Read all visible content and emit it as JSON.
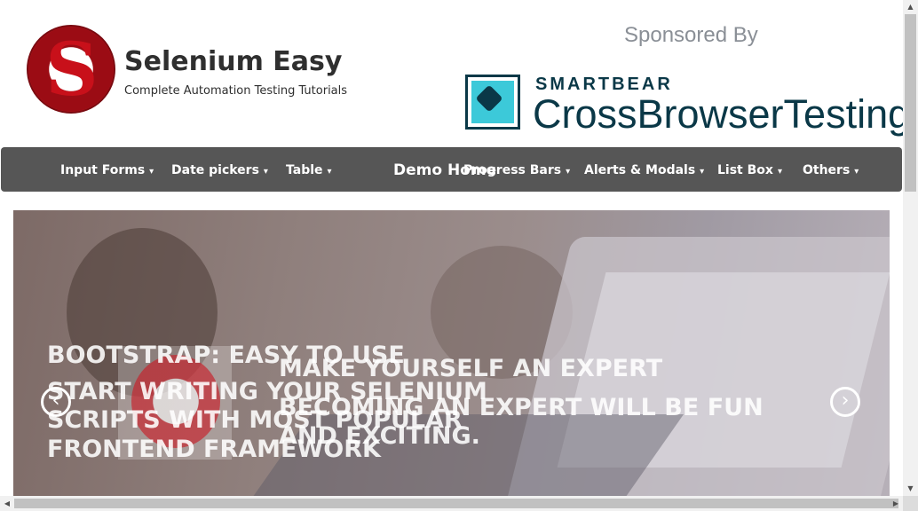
{
  "header": {
    "brand_title": "Selenium Easy",
    "brand_subtitle": "Complete Automation Testing Tutorials",
    "sponsor_label": "Sponsored By",
    "sponsor_company": "SMARTBEAR",
    "sponsor_product": "CrossBrowserTesting"
  },
  "navbar": {
    "items": [
      {
        "label": "Input Forms"
      },
      {
        "label": "Date pickers"
      },
      {
        "label": "Table"
      },
      {
        "label": "Demo Home"
      },
      {
        "label": "Progress Bars"
      },
      {
        "label": "Alerts & Modals"
      },
      {
        "label": "List Box"
      },
      {
        "label": "Others"
      }
    ],
    "caret": "▾"
  },
  "carousel": {
    "slide1_title": "Bootstrap: Easy to use",
    "slide1_text": "Start writing your Selenium scripts with most popular frontend framework",
    "slide2_title": "Make yourself an Expert",
    "slide2_text": "Becoming an expert will be fun and exciting.",
    "prev_icon": "‹",
    "next_icon": "›"
  },
  "scrollbars": {
    "up": "▲",
    "down": "▼",
    "left": "◀",
    "right": "▶"
  }
}
